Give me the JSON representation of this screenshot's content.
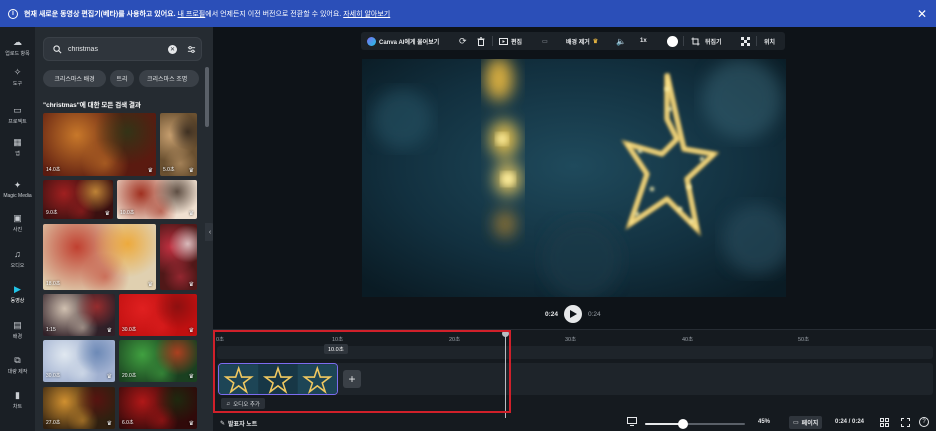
{
  "banner": {
    "bold_text": "현재 새로운 동영상 편집기(베타)를 사용하고 있어요.",
    "link1": "내 프로필",
    "middle_text": "에서 언제든지 이전 버전으로 전환할 수 있어요.",
    "link2": "자세히 알아보기",
    "close_icon": "close-icon"
  },
  "rail": {
    "items": [
      {
        "label": "업로드 항목",
        "icon": "cloud-upload-icon"
      },
      {
        "label": "도구",
        "icon": "tools-icon"
      },
      {
        "label": "프로젝트",
        "icon": "folder-icon"
      },
      {
        "label": "앱",
        "icon": "apps-icon"
      },
      {
        "label": "Magic Media",
        "icon": "magic-media-icon"
      },
      {
        "label": "사진",
        "icon": "photo-icon"
      },
      {
        "label": "오디오",
        "icon": "music-icon"
      },
      {
        "label": "동영상",
        "icon": "video-icon"
      },
      {
        "label": "배경",
        "icon": "background-icon"
      },
      {
        "label": "대량 제작",
        "icon": "bulk-create-icon"
      },
      {
        "label": "차트",
        "icon": "chart-icon"
      }
    ]
  },
  "panel": {
    "search_value": "christmas",
    "chips": [
      "크리스마스 배경",
      "트리",
      "크리스마스 조명"
    ],
    "results_title": "\"christmas\"에 대한 모든 검색 결과",
    "thumbs": [
      {
        "duration": "14.0초",
        "colors": [
          "#5a1a10",
          "#c8782a",
          "#2a3a18"
        ]
      },
      {
        "duration": "5.0초",
        "colors": [
          "#6a5030",
          "#c8a070",
          "#2a2018"
        ]
      },
      {
        "duration": "9.0초",
        "colors": [
          "#3a1010",
          "#a02020",
          "#e0a040"
        ]
      },
      {
        "duration": "10.0초",
        "colors": [
          "#f0e0d0",
          "#a03020",
          "#3a2a20"
        ]
      },
      {
        "duration": "18.0초",
        "colors": [
          "#e0d0b0",
          "#c04030",
          "#f0a020"
        ]
      },
      {
        "duration": "",
        "colors": [
          "#501818",
          "#c03040",
          "#f0e0e0"
        ]
      },
      {
        "duration": "1:15",
        "colors": [
          "#302028",
          "#d0c0b0",
          "#b03030"
        ]
      },
      {
        "duration": "30.0초",
        "colors": [
          "#c01010",
          "#e02020",
          "#801010"
        ]
      },
      {
        "duration": "30.0초",
        "colors": [
          "#a0b0d0",
          "#e0e8f0",
          "#6080b0"
        ]
      },
      {
        "duration": "20.0초",
        "colors": [
          "#1a4020",
          "#40a040",
          "#d04020"
        ]
      },
      {
        "duration": "27.0초",
        "colors": [
          "#302010",
          "#d09030",
          "#601010"
        ]
      },
      {
        "duration": "6.0초",
        "colors": [
          "#300a0a",
          "#b01818",
          "#1a3010"
        ]
      }
    ]
  },
  "toolbar": {
    "ask_ai": "Canva AI에게 물어보기",
    "edit": "편집",
    "bg_remove": "배경 제거",
    "speed": "1x",
    "flip": "뒤집기",
    "position": "위치"
  },
  "player": {
    "current_time": "0:24",
    "total_time": "0:24"
  },
  "timeline": {
    "ticks": [
      "0초",
      "10초",
      "20초",
      "30초",
      "40초",
      "50초"
    ],
    "hover_time": "10.0초",
    "add_audio": "오디오 추가",
    "add_clip": "+"
  },
  "bottom": {
    "notes_label": "발표자 노트",
    "zoom_value": "45%",
    "zoom_fraction": 0.38,
    "page_label": "페이지",
    "time_readout": "0:24 / 0:24"
  }
}
